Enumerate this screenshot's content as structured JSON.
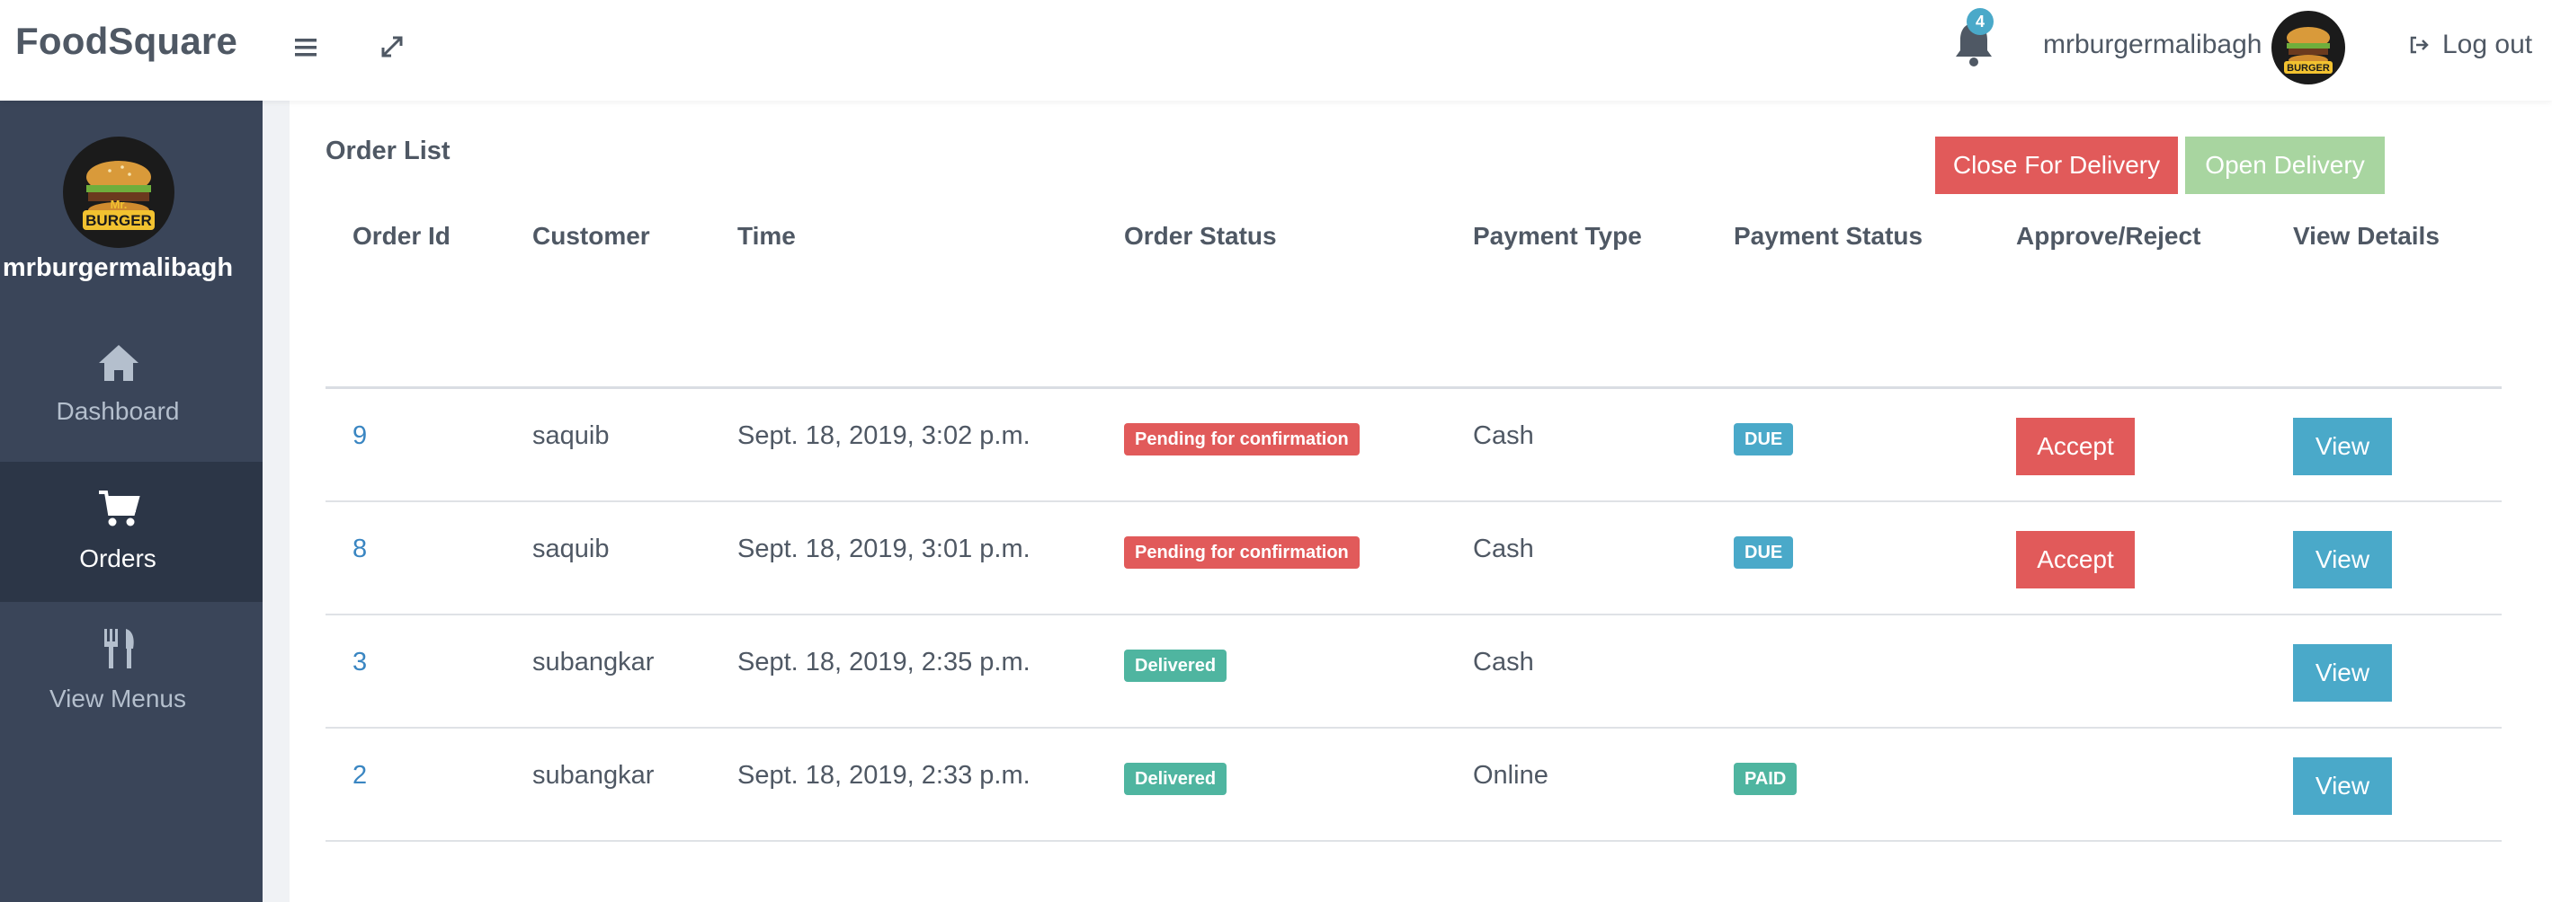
{
  "app": {
    "brand": "FoodSquare"
  },
  "header": {
    "notification_count": "4",
    "username": "mrburgermalibagh",
    "logout_label": "Log out"
  },
  "avatar": {
    "logo_lines": [
      "Mr.",
      "BURGER"
    ]
  },
  "sidebar": {
    "username": "mrburgermalibagh",
    "items": [
      {
        "label": "Dashboard",
        "icon": "home-icon",
        "active": false
      },
      {
        "label": "Orders",
        "icon": "cart-icon",
        "active": true
      },
      {
        "label": "View Menus",
        "icon": "utensils-icon",
        "active": false
      }
    ]
  },
  "page": {
    "title": "Order List",
    "close_delivery_label": "Close For Delivery",
    "open_delivery_label": "Open Delivery"
  },
  "table": {
    "headers": [
      "Order Id",
      "Customer",
      "Time",
      "Order Status",
      "Payment Type",
      "Payment Status",
      "Approve/Reject",
      "View Details"
    ],
    "rows": [
      {
        "id": "9",
        "customer": "saquib",
        "time": "Sept. 18, 2019, 3:02 p.m.",
        "order_status": "Pending for confirmation",
        "order_status_kind": "pending",
        "payment_type": "Cash",
        "payment_status": "DUE",
        "payment_status_kind": "due",
        "action": "Accept",
        "view": "View"
      },
      {
        "id": "8",
        "customer": "saquib",
        "time": "Sept. 18, 2019, 3:01 p.m.",
        "order_status": "Pending for confirmation",
        "order_status_kind": "pending",
        "payment_type": "Cash",
        "payment_status": "DUE",
        "payment_status_kind": "due",
        "action": "Accept",
        "view": "View"
      },
      {
        "id": "3",
        "customer": "subangkar",
        "time": "Sept. 18, 2019, 2:35 p.m.",
        "order_status": "Delivered",
        "order_status_kind": "delivered",
        "payment_type": "Cash",
        "payment_status": "",
        "payment_status_kind": "",
        "action": "",
        "view": "View"
      },
      {
        "id": "2",
        "customer": "subangkar",
        "time": "Sept. 18, 2019, 2:33 p.m.",
        "order_status": "Delivered",
        "order_status_kind": "delivered",
        "payment_type": "Online",
        "payment_status": "PAID",
        "payment_status_kind": "paid",
        "action": "",
        "view": "View"
      }
    ]
  },
  "colors": {
    "sidebar_bg": "#3a4559",
    "sidebar_active": "#2c3647",
    "danger": "#e15a5a",
    "success_light": "#a8d5a0",
    "info": "#4aa9c9",
    "teal": "#4fb5a0",
    "link": "#3a86c2"
  }
}
